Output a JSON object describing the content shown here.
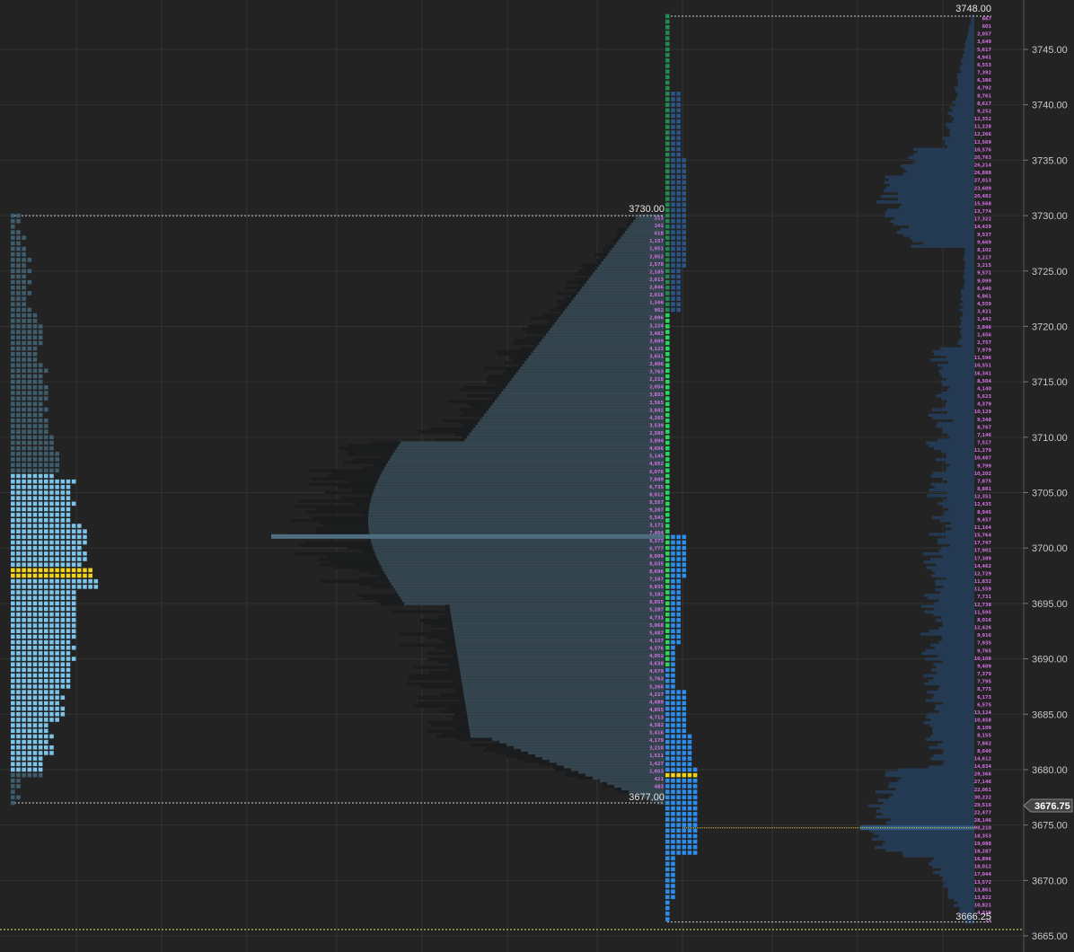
{
  "chart_data": {
    "type": "market_profile",
    "price_axis": {
      "min": 3664.5,
      "max": 3749.0,
      "tick_step": 5,
      "tick_labels": [
        "3745.00",
        "3740.00",
        "3735.00",
        "3730.00",
        "3725.00",
        "3720.00",
        "3715.00",
        "3710.00",
        "3705.00",
        "3700.00",
        "3695.00",
        "3690.00",
        "3685.00",
        "3680.00",
        "3675.00",
        "3670.00",
        "3665.00"
      ],
      "current_price": "3676.75"
    },
    "grid": true,
    "sessions": [
      {
        "name": "prior",
        "high": 3730.0,
        "low": 3677.0,
        "high_label": "3730.00",
        "low_label": "3677.00",
        "tpo_poc": 3697.75,
        "volume_poc": 3701.0,
        "value_area": [
          3679.75,
          3706.75
        ]
      },
      {
        "name": "current",
        "high": 3748.0,
        "low": 3666.25,
        "high_label": "3748.00",
        "low_label": "3666.25",
        "tpo_poc": 3679.5,
        "volume_poc": 3674.75
      }
    ],
    "volume_labels_prior": [
      "211",
      "241",
      "618",
      "1,157",
      "1,951",
      "2,052",
      "2,578",
      "2,185",
      "2,613",
      "2,846",
      "2,016",
      "1,346",
      "952",
      "2,896",
      "3,224",
      "3,483",
      "3,609",
      "4,123",
      "3,651",
      "3,406",
      "3,763",
      "2,218",
      "2,054",
      "3,853",
      "3,565",
      "3,842",
      "4,265",
      "3,539",
      "2,580",
      "3,894",
      "4,696",
      "5,145",
      "4,952",
      "6,076",
      "7,049",
      "6,735",
      "8,012",
      "8,557",
      "9,267",
      "5,543",
      "3,171",
      "7,404",
      "9,373",
      "6,777",
      "8,099",
      "8,035",
      "8,696",
      "7,167",
      "9,935",
      "5,182",
      "8,855",
      "5,287",
      "4,731",
      "5,068",
      "5,487",
      "4,157",
      "4,576",
      "4,052",
      "4,638",
      "4,679",
      "5,763",
      "5,266",
      "4,227",
      "4,489",
      "4,855",
      "4,713",
      "4,582",
      "5,416",
      "4,179",
      "3,210",
      "1,511",
      "1,427",
      "1,053",
      "421",
      "483"
    ],
    "volume_labels_current": [
      "667",
      "601",
      "2,057",
      "3,649",
      "5,617",
      "4,941",
      "6,553",
      "7,392",
      "6,386",
      "4,792",
      "8,761",
      "8,617",
      "9,252",
      "12,352",
      "11,228",
      "12,266",
      "12,569",
      "10,576",
      "20,763",
      "26,214",
      "26,888",
      "27,013",
      "23,609",
      "20,482",
      "15,568",
      "13,774",
      "17,322",
      "14,429",
      "9,537",
      "9,669",
      "8,102",
      "3,217",
      "3,215",
      "9,571",
      "9,099",
      "6,640",
      "6,861",
      "4,559",
      "3,421",
      "1,442",
      "2,846",
      "1,456",
      "2,757",
      "7,979",
      "11,596",
      "10,551",
      "16,341",
      "8,504",
      "4,140",
      "5,623",
      "4,379",
      "10,129",
      "9,348",
      "8,767",
      "7,146",
      "7,517",
      "11,279",
      "10,487",
      "9,799",
      "10,202",
      "7,875",
      "8,881",
      "12,351",
      "12,435",
      "8,945",
      "9,457",
      "11,164",
      "15,764",
      "17,747",
      "17,901",
      "17,389",
      "14,462",
      "12,729",
      "11,832",
      "11,559",
      "7,731",
      "12,738",
      "11,595",
      "8,016",
      "12,426",
      "9,916",
      "7,935",
      "9,765",
      "10,108",
      "9,409",
      "7,379",
      "7,795",
      "8,775",
      "6,173",
      "6,575",
      "13,124",
      "10,458",
      "8,109",
      "8,155",
      "7,862",
      "8,640",
      "14,612",
      "14,834",
      "29,366",
      "27,146",
      "22,061",
      "30,222",
      "29,516",
      "22,477",
      "28,146",
      "98,210",
      "18,353",
      "19,088",
      "18,287",
      "16,896",
      "18,012",
      "17,044",
      "13,572",
      "13,861",
      "13,822",
      "10,821",
      "4,219",
      "25"
    ],
    "colors": {
      "background": "#232323",
      "grid": "#333333",
      "tpo_out_value": "#3f5d6c",
      "tpo_in_value": "#7cc4ea",
      "tpo_poc": "#f2d21c",
      "volume_profile_prior": "#34454f",
      "volume_shadow": "#1a1c1d",
      "volume_poc_line": "#4e6e80",
      "current_green_dark": "#218a4f",
      "current_green_bright": "#27d85f",
      "current_blue_dark": "#2a5586",
      "current_blue_bright": "#2d8dea",
      "volume_profile_current": "#243a52",
      "volume_labels": "#d070e0",
      "price_badge": "#444444"
    }
  }
}
